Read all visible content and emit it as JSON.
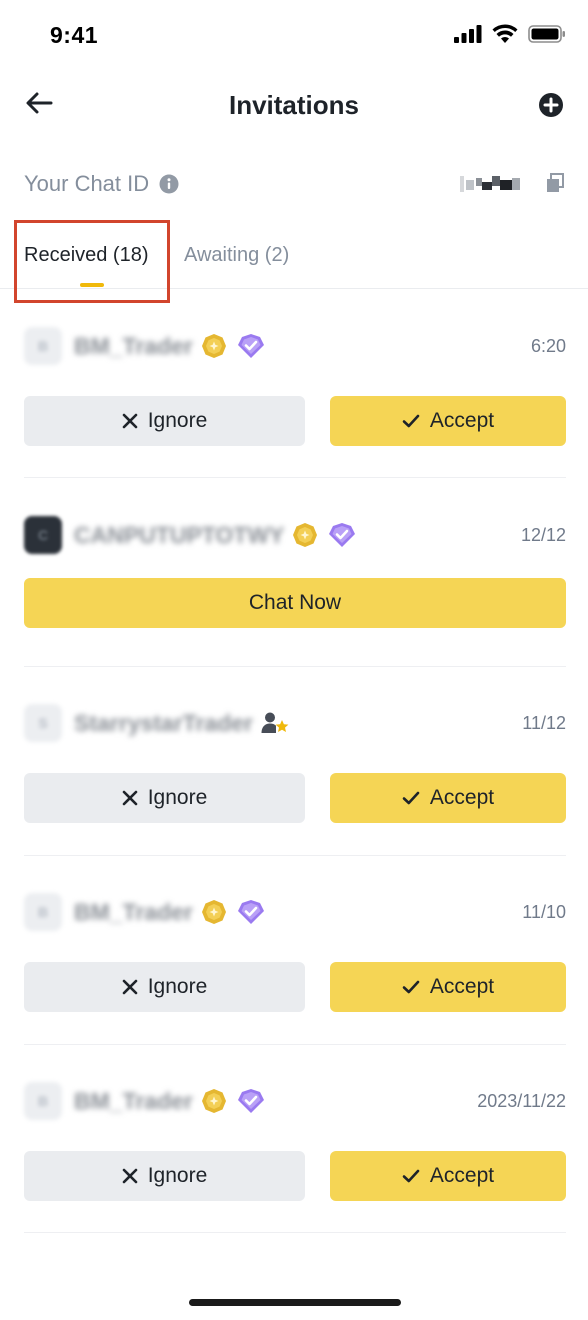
{
  "status_bar": {
    "time": "9:41"
  },
  "header": {
    "title": "Invitations"
  },
  "chat_id": {
    "label": "Your Chat ID"
  },
  "tabs": [
    {
      "label": "Received (18)",
      "active": true
    },
    {
      "label": "Awaiting (2)",
      "active": false
    }
  ],
  "buttons": {
    "ignore_label": "Ignore",
    "accept_label": "Accept",
    "chat_now_label": "Chat Now"
  },
  "invitations": [
    {
      "avatar_letter": "B",
      "username": "BM_Trader",
      "badges": [
        "gold-badge-icon",
        "diamond-badge-icon"
      ],
      "time": "6:20",
      "actions": "ignore_accept"
    },
    {
      "avatar_letter": "C",
      "username": "CANPUTUPTOTWY",
      "badges": [
        "gold-badge-icon",
        "diamond-badge-icon"
      ],
      "time": "12/12",
      "actions": "chat_now"
    },
    {
      "avatar_letter": "S",
      "username": "StarrystarTrader",
      "badges": [
        "user-star-icon"
      ],
      "time": "11/12",
      "actions": "ignore_accept"
    },
    {
      "avatar_letter": "B",
      "username": "BM_Trader",
      "badges": [
        "gold-badge-icon",
        "diamond-badge-icon"
      ],
      "time": "11/10",
      "actions": "ignore_accept"
    },
    {
      "avatar_letter": "B",
      "username": "BM_Trader",
      "badges": [
        "gold-badge-icon",
        "diamond-badge-icon"
      ],
      "time": "2023/11/22",
      "actions": "ignore_accept"
    }
  ],
  "colors": {
    "accent_yellow": "#f5d555",
    "tab_indicator": "#f0b90b",
    "highlight_red": "#d2452d",
    "ignore_bg": "#eaecef",
    "text_primary": "#1e2329",
    "text_secondary": "#848e9c"
  }
}
